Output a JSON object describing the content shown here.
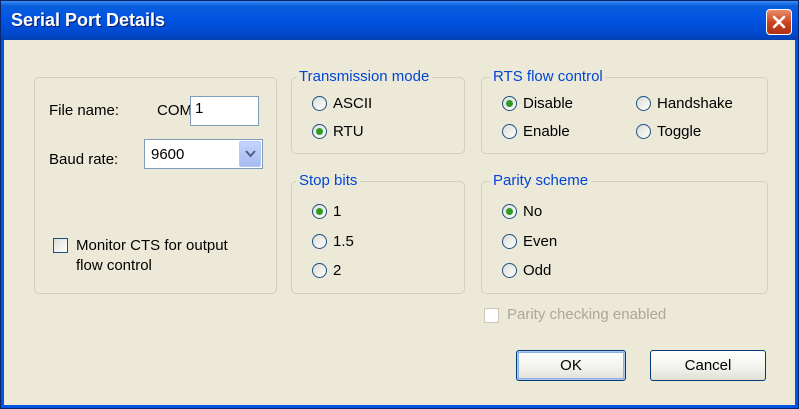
{
  "window": {
    "title": "Serial Port Details",
    "close_icon": "close-icon"
  },
  "port": {
    "file_name_label": "File name:",
    "com_prefix": "COM",
    "com_value": "1",
    "baud_label": "Baud rate:",
    "baud_value": "9600",
    "monitor_cts_label": "Monitor CTS for output flow control",
    "monitor_cts_line1": "Monitor CTS for output",
    "monitor_cts_line2": "flow control",
    "monitor_cts_checked": false
  },
  "transmission_mode": {
    "title": "Transmission mode",
    "options": [
      {
        "label": "ASCII",
        "selected": false
      },
      {
        "label": "RTU",
        "selected": true
      }
    ]
  },
  "rts_flow_control": {
    "title": "RTS flow control",
    "options": [
      {
        "label": "Disable",
        "selected": true
      },
      {
        "label": "Handshake",
        "selected": false
      },
      {
        "label": "Enable",
        "selected": false
      },
      {
        "label": "Toggle",
        "selected": false
      }
    ]
  },
  "stop_bits": {
    "title": "Stop bits",
    "options": [
      {
        "label": "1",
        "selected": true
      },
      {
        "label": "1.5",
        "selected": false
      },
      {
        "label": "2",
        "selected": false
      }
    ]
  },
  "parity_scheme": {
    "title": "Parity scheme",
    "options": [
      {
        "label": "No",
        "selected": true
      },
      {
        "label": "Even",
        "selected": false
      },
      {
        "label": "Odd",
        "selected": false
      }
    ]
  },
  "parity_checking": {
    "label": "Parity checking enabled",
    "enabled": false,
    "checked": false
  },
  "buttons": {
    "ok": "OK",
    "cancel": "Cancel"
  }
}
